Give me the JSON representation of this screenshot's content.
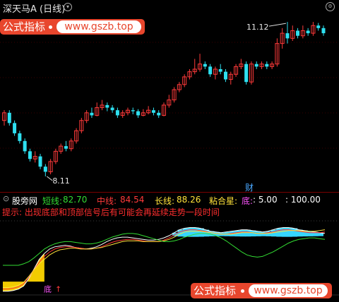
{
  "header": {
    "title": "深天马A (日线)",
    "settings_icon": "chevron-down-icon"
  },
  "colors": {
    "up": "#ff3a3a",
    "down": "#2ee0f0",
    "short": "#ffffff",
    "mid": "#ff3333",
    "long": "#ffe23a",
    "sticky": "#33dd33",
    "bottom": "#ffd700",
    "accent": "#e8462d"
  },
  "price_chart": {
    "high_label": "11.12",
    "low_label": "8.11",
    "cai_badge": "财"
  },
  "banners": {
    "top": {
      "label": "公式指标",
      "url": "www.gszb.top"
    },
    "bottom": {
      "label": "公式指标",
      "url": "www.gszb.top"
    }
  },
  "indicator": {
    "name": "股旁网",
    "short_label": "短线:",
    "short_value": "82.70",
    "mid_label": "中线:",
    "mid_value": "84.54",
    "long_label": "长线:",
    "long_value": "88.26",
    "sticky_label": "粘合星:",
    "bottom_label": "底:",
    "bottom_value": ": 5.00",
    "extra_value": ": 100.00",
    "tip": "提示: 出现底部和顶部信号后有可能会再延续走势一段时间",
    "bottom_marker": "底"
  },
  "chart_data": {
    "type": "candlestick",
    "candles": [
      [
        9.2,
        9.35,
        9.4,
        9.1
      ],
      [
        9.35,
        9.15,
        9.4,
        9.1
      ],
      [
        9.15,
        8.95,
        9.2,
        8.9
      ],
      [
        8.95,
        8.8,
        9.0,
        8.75
      ],
      [
        8.8,
        8.6,
        8.85,
        8.55
      ],
      [
        8.6,
        8.45,
        8.65,
        8.4
      ],
      [
        8.45,
        8.5,
        8.6,
        8.38
      ],
      [
        8.5,
        8.3,
        8.55,
        8.25
      ],
      [
        8.3,
        8.2,
        8.35,
        8.11
      ],
      [
        8.2,
        8.4,
        8.45,
        8.15
      ],
      [
        8.4,
        8.6,
        8.65,
        8.35
      ],
      [
        8.6,
        8.7,
        8.75,
        8.55
      ],
      [
        8.7,
        8.65,
        8.8,
        8.6
      ],
      [
        8.65,
        8.8,
        8.85,
        8.6
      ],
      [
        8.8,
        9.0,
        9.05,
        8.75
      ],
      [
        9.0,
        9.2,
        9.25,
        8.95
      ],
      [
        9.2,
        9.35,
        9.4,
        9.15
      ],
      [
        9.35,
        9.3,
        9.45,
        9.25
      ],
      [
        9.3,
        9.45,
        9.55,
        9.28
      ],
      [
        9.45,
        9.5,
        9.6,
        9.4
      ],
      [
        9.5,
        9.45,
        9.55,
        9.38
      ],
      [
        9.45,
        9.4,
        9.5,
        9.35
      ],
      [
        9.4,
        9.3,
        9.45,
        9.25
      ],
      [
        9.3,
        9.35,
        9.4,
        9.25
      ],
      [
        9.35,
        9.4,
        9.45,
        9.3
      ],
      [
        9.4,
        9.38,
        9.45,
        9.32
      ],
      [
        9.38,
        9.3,
        9.42,
        9.25
      ],
      [
        9.3,
        9.35,
        9.42,
        9.28
      ],
      [
        9.35,
        9.4,
        9.48,
        9.32
      ],
      [
        9.4,
        9.35,
        9.45,
        9.3
      ],
      [
        9.35,
        9.3,
        9.4,
        9.25
      ],
      [
        9.3,
        9.5,
        9.55,
        9.28
      ],
      [
        9.5,
        9.6,
        9.7,
        9.45
      ],
      [
        9.6,
        9.8,
        9.85,
        9.55
      ],
      [
        9.8,
        9.9,
        9.95,
        9.75
      ],
      [
        9.9,
        10.05,
        10.1,
        9.85
      ],
      [
        10.05,
        10.15,
        10.2,
        10.0
      ],
      [
        10.15,
        10.2,
        10.4,
        10.1
      ],
      [
        10.2,
        10.3,
        10.5,
        10.15
      ],
      [
        10.3,
        10.25,
        10.35,
        10.2
      ],
      [
        10.25,
        10.1,
        10.3,
        10.05
      ],
      [
        10.1,
        10.2,
        10.25,
        10.0
      ],
      [
        10.2,
        10.15,
        10.3,
        10.1
      ],
      [
        10.15,
        10.0,
        10.2,
        9.95
      ],
      [
        10.0,
        10.1,
        10.15,
        9.9
      ],
      [
        10.1,
        10.25,
        10.3,
        10.05
      ],
      [
        10.25,
        10.3,
        10.4,
        10.2
      ],
      [
        10.3,
        9.95,
        10.35,
        9.9
      ],
      [
        9.95,
        10.3,
        10.35,
        9.9
      ],
      [
        10.3,
        10.25,
        10.35,
        10.2
      ],
      [
        10.25,
        10.3,
        10.35,
        10.2
      ],
      [
        10.3,
        10.25,
        10.35,
        10.2
      ],
      [
        10.25,
        10.3,
        10.35,
        10.2
      ],
      [
        10.3,
        10.7,
        10.8,
        10.25
      ],
      [
        10.7,
        10.9,
        11.0,
        10.6
      ],
      [
        10.9,
        10.8,
        11.12,
        10.7
      ],
      [
        10.8,
        10.95,
        11.05,
        10.75
      ],
      [
        10.95,
        10.85,
        11.0,
        10.8
      ],
      [
        10.85,
        10.95,
        11.05,
        10.8
      ],
      [
        10.95,
        10.9,
        11.0,
        10.85
      ],
      [
        10.9,
        11.05,
        11.12,
        10.85
      ],
      [
        11.05,
        11.0,
        11.1,
        10.95
      ],
      [
        11.0,
        10.9,
        11.05,
        10.85
      ]
    ],
    "indicator_series": [
      {
        "name": "短线",
        "values": [
          5,
          5,
          6,
          8,
          12,
          22,
          35,
          48,
          56,
          62,
          65,
          66,
          67,
          66,
          64,
          63,
          62,
          63,
          65,
          68,
          72,
          75,
          77,
          78,
          78,
          77,
          76,
          75,
          74,
          74,
          75,
          77,
          80,
          84,
          88,
          90,
          91,
          91,
          90,
          88,
          86,
          85,
          84,
          85,
          86,
          87,
          88,
          88,
          87,
          86,
          85,
          86,
          88,
          90,
          91,
          91,
          90,
          88,
          87,
          86,
          85,
          84,
          83
        ]
      },
      {
        "name": "中线",
        "values": [
          8,
          8,
          9,
          11,
          15,
          24,
          34,
          44,
          52,
          58,
          62,
          64,
          65,
          65,
          64,
          63,
          62,
          62,
          63,
          65,
          68,
          71,
          73,
          74,
          75,
          75,
          74,
          73,
          72,
          72,
          72,
          74,
          77,
          81,
          85,
          87,
          88,
          88,
          87,
          86,
          84,
          83,
          82,
          82,
          83,
          84,
          85,
          85,
          84,
          83,
          83,
          84,
          85,
          87,
          88,
          88,
          87,
          86,
          85,
          84,
          84,
          84,
          85
        ]
      },
      {
        "name": "长线",
        "values": [
          10,
          10,
          11,
          13,
          17,
          25,
          34,
          42,
          48,
          54,
          58,
          61,
          62,
          63,
          63,
          62,
          62,
          62,
          63,
          64,
          66,
          68,
          70,
          72,
          73,
          73,
          73,
          72,
          72,
          72,
          72,
          73,
          75,
          78,
          82,
          85,
          86,
          86,
          86,
          85,
          84,
          83,
          82,
          82,
          82,
          83,
          84,
          84,
          84,
          83,
          83,
          83,
          84,
          85,
          86,
          87,
          87,
          87,
          86,
          86,
          86,
          87,
          88
        ]
      },
      {
        "name": "粘合星",
        "values": [
          40,
          40,
          40,
          40,
          42,
          45,
          50,
          56,
          62,
          66,
          69,
          71,
          72,
          72,
          71,
          70,
          69,
          69,
          70,
          72,
          75,
          78,
          80,
          82,
          83,
          83,
          82,
          80,
          78,
          76,
          74,
          72,
          72,
          73,
          75,
          78,
          80,
          82,
          83,
          83,
          82,
          80,
          77,
          73,
          68,
          63,
          58,
          54,
          52,
          51,
          52,
          55,
          58,
          62,
          66,
          70,
          73,
          75,
          76,
          77,
          77,
          76,
          75
        ]
      }
    ],
    "ylim": [
      8.0,
      11.3
    ]
  }
}
